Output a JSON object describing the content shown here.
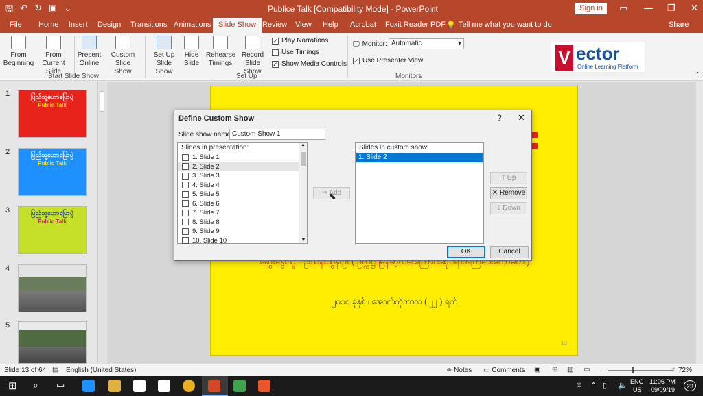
{
  "app": {
    "title": "Publice Talk [Compatibility Mode]  -  PowerPoint",
    "signin_label": "Sign in"
  },
  "tabs": [
    "File",
    "Home",
    "Insert",
    "Design",
    "Transitions",
    "Animations",
    "Slide Show",
    "Review",
    "View",
    "Help",
    "Acrobat",
    "Foxit Reader PDF"
  ],
  "tell_me": "Tell me what you want to do",
  "share": "Share",
  "ribbon": {
    "from_beginning": "From\nBeginning",
    "from_current": "From\nCurrent Slide",
    "present_online": "Present\nOnline",
    "custom_show": "Custom Slide\nShow",
    "start_group": "Start Slide Show",
    "setup_show": "Set Up\nSlide Show",
    "hide_slide": "Hide\nSlide",
    "rehearse": "Rehearse\nTimings",
    "record": "Record Slide\nShow",
    "play_narrations": "Play Narrations",
    "use_timings": "Use Timings",
    "show_media": "Show Media Controls",
    "setup_group": "Set Up",
    "monitor_label": "Monitor:",
    "monitor_value": "Automatic",
    "presenter_view": "Use Presenter View",
    "monitors_group": "Monitors"
  },
  "logo": {
    "name": "ector",
    "letter": "V",
    "tagline": "Online Learning Platform"
  },
  "thumbnails": [
    {
      "num": "1",
      "title": "ပြည်သူ့ဟောပြောပွဲ",
      "subtitle": "Public Talk"
    },
    {
      "num": "2",
      "title": "ပြည်သူ့ဟောပြောပွဲ",
      "subtitle": "Public Talk"
    },
    {
      "num": "3",
      "title": "ပြည်သူ့ဟောပြောပွဲ",
      "subtitle": "Public Talk"
    },
    {
      "num": "4"
    },
    {
      "num": "5"
    }
  ],
  "slide": {
    "line1": "ဆွေးနွေးသူ - ဦးသန်းထွန်းဦး ( ဥက္ကဋ္ဌ-မြန်မာ့လမ်းကြောင်းဆိုင်ရာအကြံပေးကော်မတီ )",
    "line2": "၂၀၁၈ ခုနှစ် ၊ အောက်တိုဘာလ ( ၂၂ ) ရက်",
    "page": "13"
  },
  "dialog": {
    "title": "Define Custom Show",
    "help": "?",
    "close": "✕",
    "name_label": "Slide show name:",
    "name_value": "Custom Show 1",
    "left_header": "Slides in presentation:",
    "right_header": "Slides in custom show:",
    "slides": [
      "1. Slide 1",
      "2. Slide 2",
      "3. Slide 3",
      "4. Slide 4",
      "5. Slide 5",
      "6. Slide 6",
      "7. Slide 7",
      "8. Slide 8",
      "9. Slide 9",
      "10. Slide 10"
    ],
    "custom_slides": [
      "1. Slide 2"
    ],
    "add": "Add",
    "up": "Up",
    "remove": "Remove",
    "down": "Down",
    "ok": "OK",
    "cancel": "Cancel"
  },
  "status": {
    "slide_info": "Slide 13 of 64",
    "language": "English (United States)",
    "notes": "Notes",
    "comments": "Comments",
    "zoom": "72%"
  },
  "taskbar": {
    "lang1": "ENG",
    "lang2": "US",
    "time": "11:06 PM",
    "date": "09/09/19",
    "badge": "23"
  },
  "colors": {
    "accent": "#b7472a",
    "slide_bg": "#ffee00",
    "selection": "#0078d7"
  }
}
